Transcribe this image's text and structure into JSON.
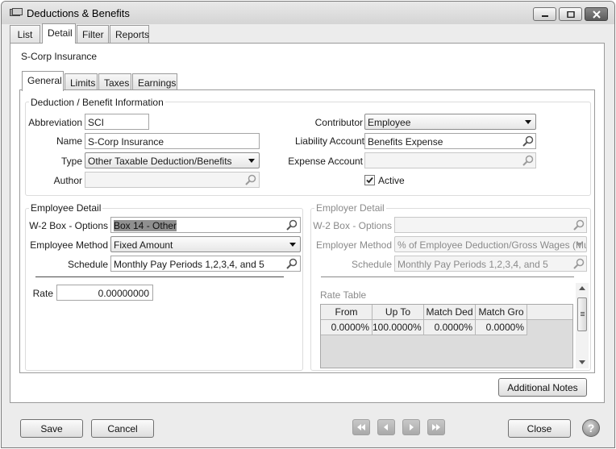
{
  "window": {
    "title": "Deductions & Benefits"
  },
  "main_tabs": [
    "List",
    "Detail",
    "Filter",
    "Reports"
  ],
  "record_title": "S-Corp Insurance",
  "sub_tabs": [
    "General",
    "Limits",
    "Taxes",
    "Earnings"
  ],
  "info_group": {
    "legend": "Deduction / Benefit Information",
    "abbreviation_label": "Abbreviation",
    "abbreviation_value": "SCI",
    "name_label": "Name",
    "name_value": "S-Corp Insurance",
    "type_label": "Type",
    "type_value": "Other Taxable Deduction/Benefits",
    "author_label": "Author",
    "author_value": "",
    "contributor_label": "Contributor",
    "contributor_value": "Employee",
    "liability_label": "Liability Account",
    "liability_value": "Benefits Expense",
    "expense_label": "Expense Account",
    "expense_value": "",
    "active_label": "Active",
    "active_checked": true
  },
  "employee_detail": {
    "legend": "Employee Detail",
    "w2_label": "W-2 Box - Options",
    "w2_value": "Box 14 - Other",
    "method_label": "Employee Method",
    "method_value": "Fixed Amount",
    "schedule_label": "Schedule",
    "schedule_value": "Monthly Pay Periods 1,2,3,4, and 5",
    "rate_label": "Rate",
    "rate_value": "0.00000000"
  },
  "employer_detail": {
    "legend": "Employer Detail",
    "w2_label": "W-2 Box - Options",
    "w2_value": "",
    "method_label": "Employer Method",
    "method_value": "% of Employee Deduction/Gross Wages (Mul",
    "schedule_label": "Schedule",
    "schedule_value": "Monthly Pay Periods 1,2,3,4, and 5",
    "rate_table_label": "Rate Table",
    "rate_table": {
      "columns": [
        "From",
        "Up To",
        "Match Ded",
        "Match Gro"
      ],
      "rows": [
        [
          "0.0000%",
          "100.0000%",
          "0.0000%",
          "0.0000%"
        ]
      ]
    }
  },
  "buttons": {
    "additional_notes": "Additional Notes",
    "save": "Save",
    "cancel": "Cancel",
    "close": "Close",
    "help": "?"
  },
  "colors": {
    "window_bg": "#ececec",
    "panel_bg": "#ffffff",
    "border": "#9a9a9a",
    "disabled_text": "#8a8a8a",
    "nav_button": "#b5b5b5"
  },
  "icons": [
    "app-icon",
    "minimize-icon",
    "maximize-icon",
    "close-icon",
    "magnifier-icon",
    "dropdown-arrow-icon",
    "checkmark-icon",
    "first-record-icon",
    "previous-record-icon",
    "next-record-icon",
    "last-record-icon",
    "help-icon"
  ]
}
